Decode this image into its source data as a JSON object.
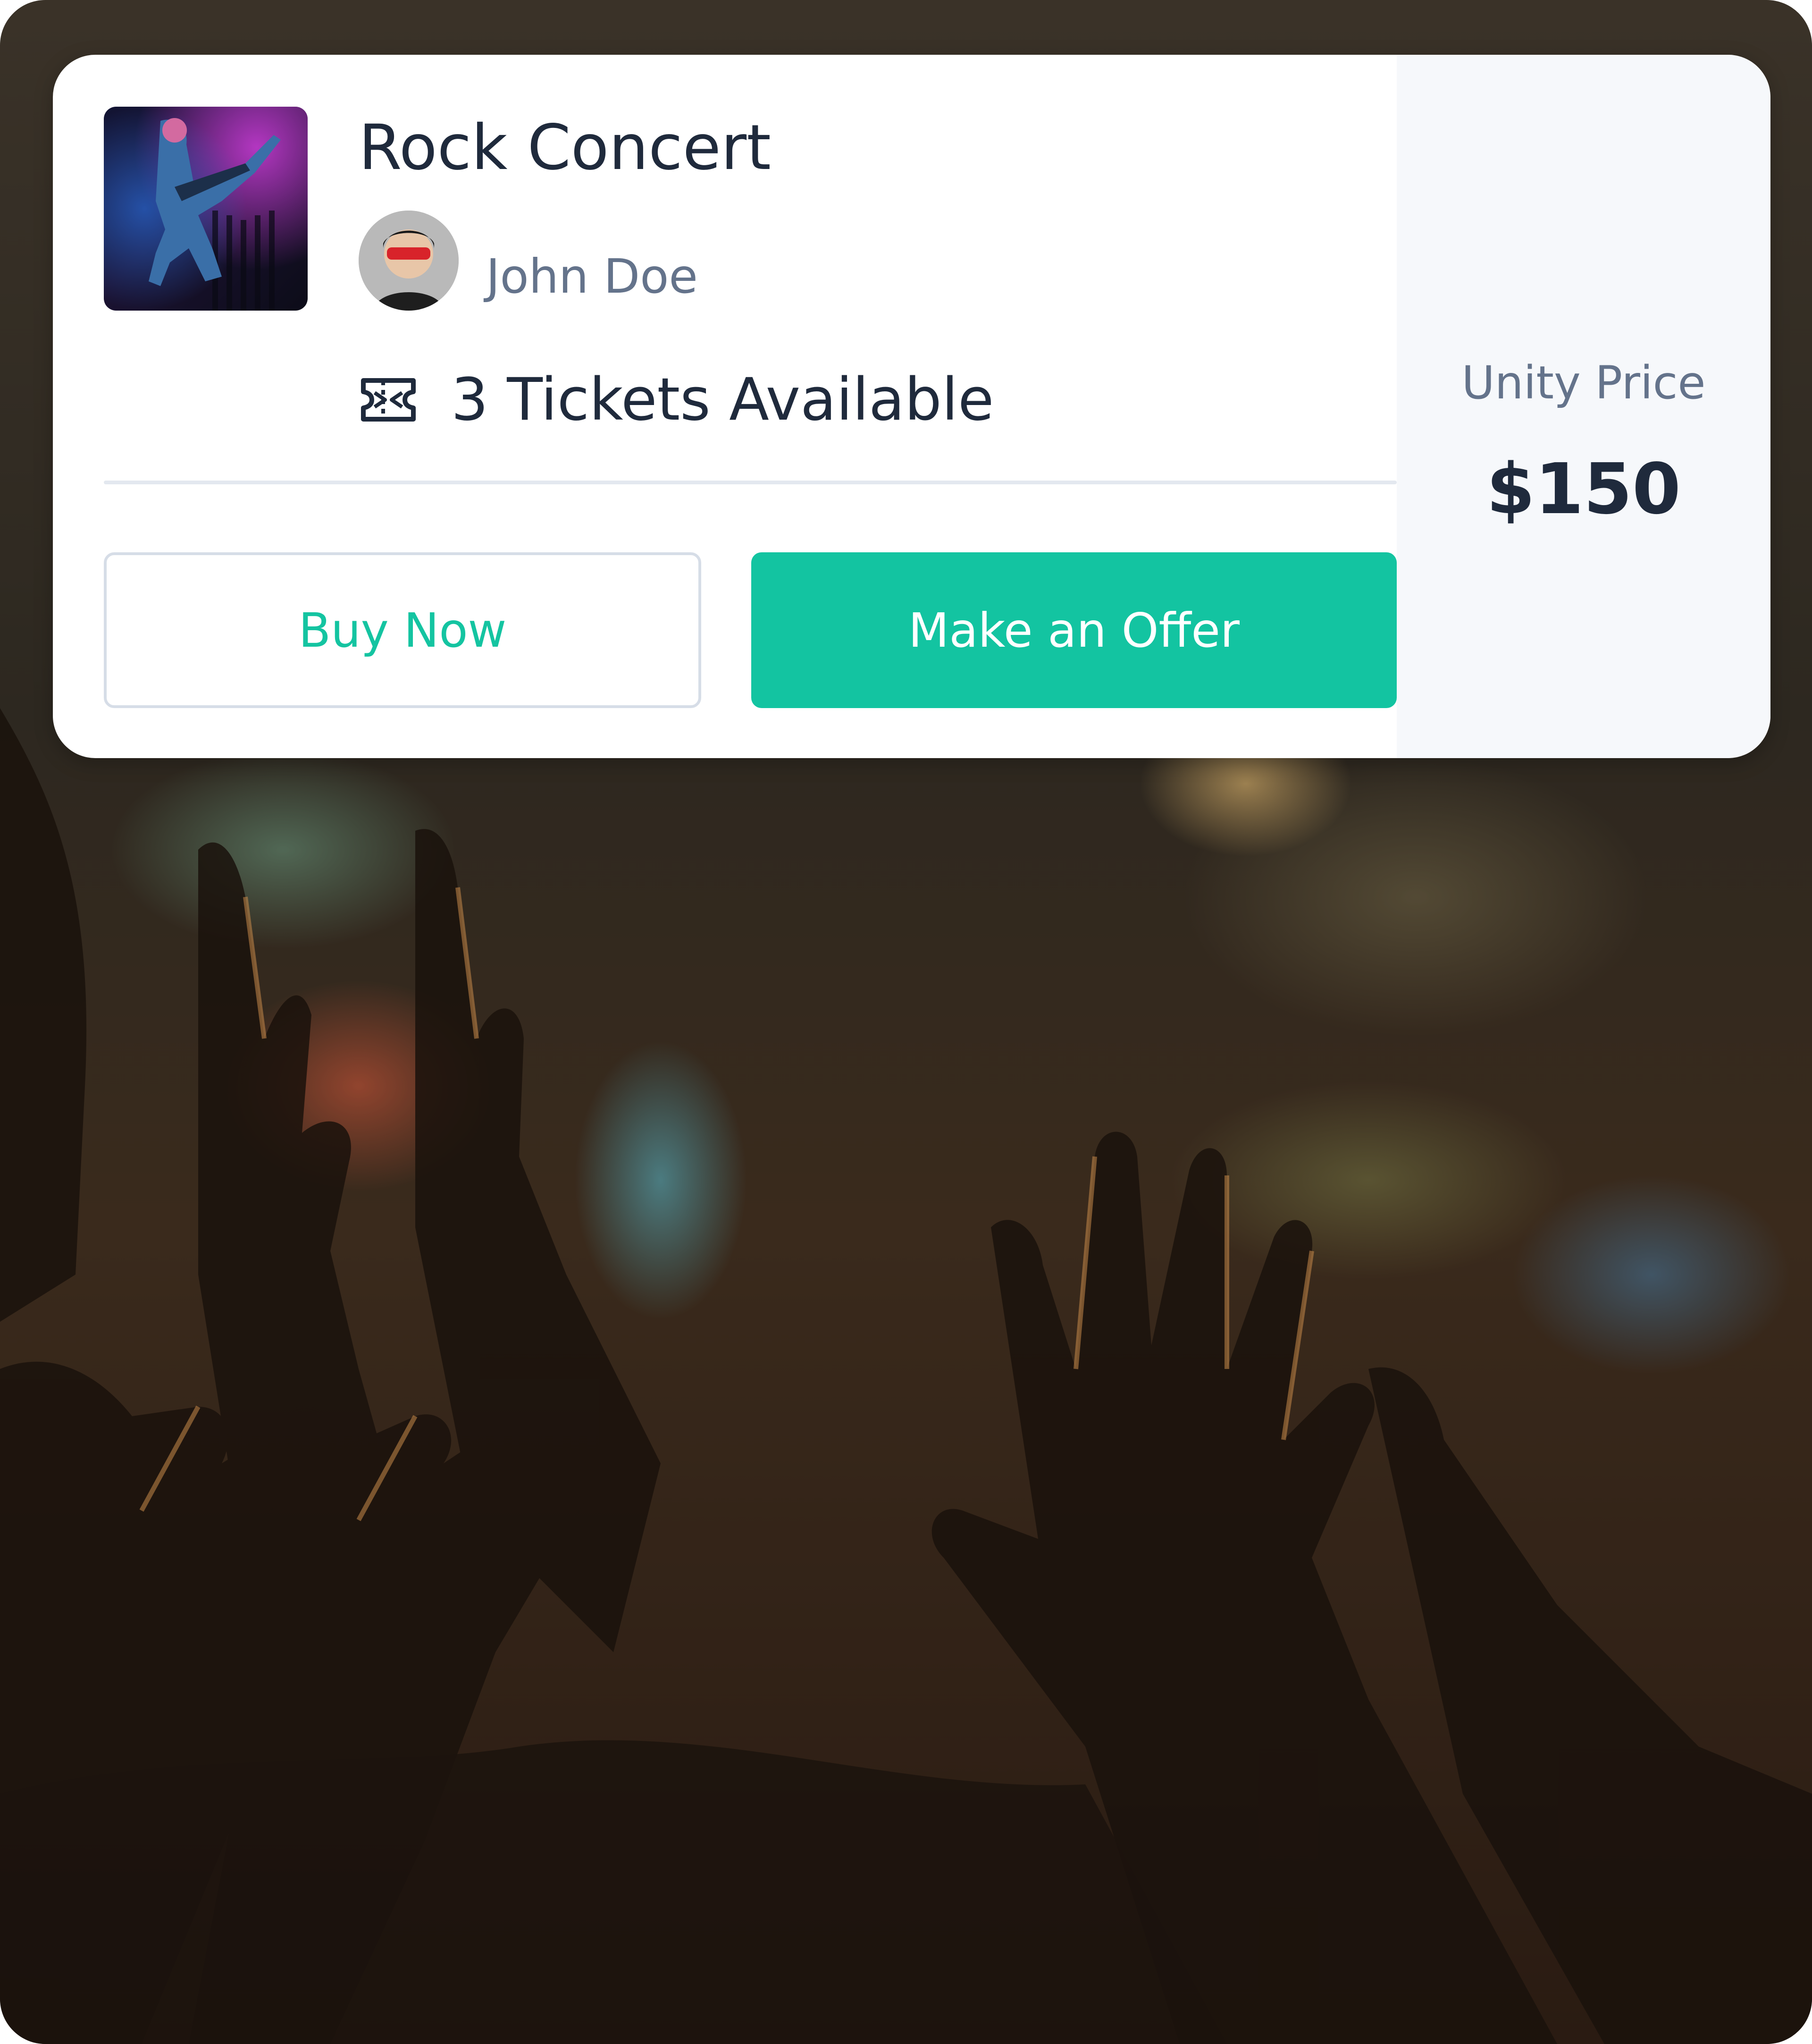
{
  "listing": {
    "title": "Rock Concert",
    "seller_name": "John Doe",
    "tickets_available": "3 Tickets Available",
    "buy_label": "Buy Now",
    "offer_label": "Make an Offer",
    "price_label": "Unity Price",
    "price_value": "$150"
  },
  "icons": {
    "ticket": "ticket-icon"
  },
  "colors": {
    "accent": "#13c4a1",
    "text_primary": "#1f2a3c",
    "text_secondary": "#64738b",
    "price_panel_bg": "#f6f8fb"
  }
}
